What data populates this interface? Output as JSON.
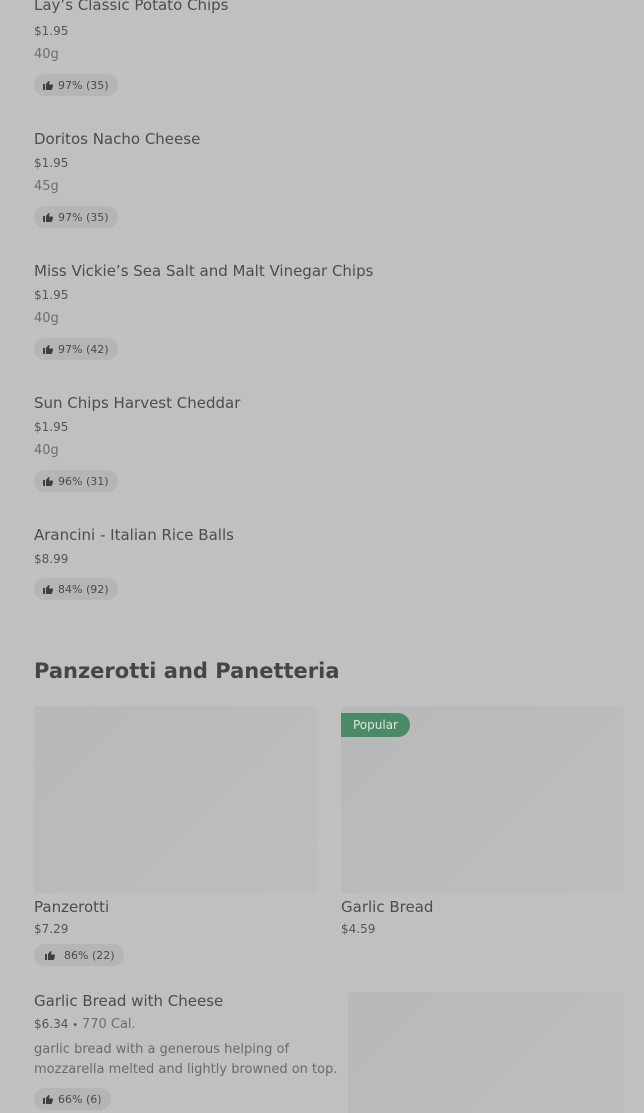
{
  "items": [
    {
      "name": "Lay’s Classic Potato Chips",
      "price": "$1.95",
      "weight": "40g",
      "rating": "97% (35)"
    },
    {
      "name": "Doritos Nacho Cheese",
      "price": "$1.95",
      "weight": "45g",
      "rating": "97% (35)"
    },
    {
      "name": "Miss Vickie’s Sea Salt and Malt Vinegar Chips",
      "price": "$1.95",
      "weight": "40g",
      "rating": "97% (42)"
    },
    {
      "name": "Sun Chips Harvest Cheddar",
      "price": "$1.95",
      "weight": "40g",
      "rating": "96% (31)"
    },
    {
      "name": "Arancini - Italian Rice Balls",
      "price": "$8.99",
      "rating": "84% (92)"
    }
  ],
  "section": {
    "title": "Panzerotti and Panetteria",
    "cards": [
      {
        "name": "Panzerotti",
        "price": "$7.29",
        "rating": "86% (22)"
      },
      {
        "name": "Garlic Bread",
        "price": "$4.59",
        "badge": "Popular"
      }
    ],
    "wide_item": {
      "name": "Garlic Bread with Cheese",
      "price": "$6.34",
      "separator": "•",
      "calories": "770 Cal.",
      "description_line1": "garlic bread with a generous helping of",
      "description_line2": "mozzarella melted and lightly browned on top.",
      "rating": "66% (6)"
    }
  },
  "icons": {
    "rating": "thumbs-up-icon"
  },
  "colors": {
    "background": "#c0c0c0",
    "badge": "#4b8a67"
  }
}
